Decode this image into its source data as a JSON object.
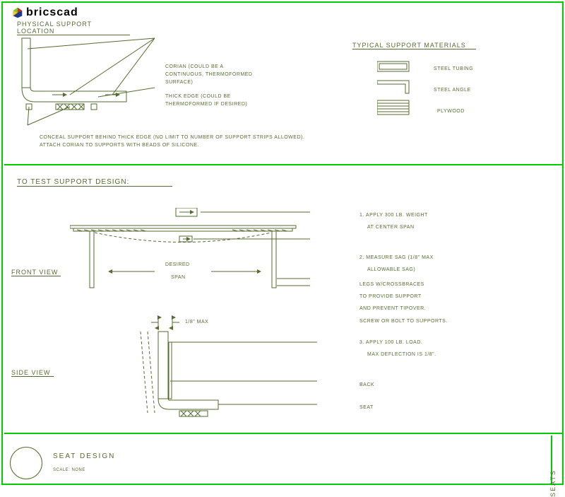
{
  "logo": "bricscad",
  "section1": {
    "title": "PHYSICAL SUPPORT LOCATION",
    "ann_corian": "CORIAN (COULD BE A",
    "ann_corian2": "CONTINUOUS, THERMOFORMED",
    "ann_corian3": "SURFACE)",
    "ann_thick": "THICK EDGE (COULD BE",
    "ann_thick2": "THERMOFORMED IF DESIRED)",
    "ann_conceal": "CONCEAL SUPPORT BEHIND THICK EDGE (NO LIMIT TO NUMBER OF SUPPORT STRIPS ALLOWED).",
    "ann_attach": "ATTACH CORIAN TO SUPPORTS WITH BEADS OF SILICONE."
  },
  "materials": {
    "title": "TYPICAL SUPPORT MATERIALS",
    "tubing": "STEEL TUBING",
    "angle": "STEEL ANGLE",
    "plywood": "PLYWOOD"
  },
  "section2": {
    "title": "TO TEST SUPPORT DESIGN:",
    "front": "FRONT VIEW",
    "side": "SIDE VIEW",
    "desired": "DESIRED",
    "span": "SPAN",
    "max": "1/8\" MAX",
    "step1a": "1. APPLY 300 LB. WEIGHT",
    "step1b": "AT CENTER SPAN",
    "step2a": "2. MEASURE SAG (1/8\" MAX",
    "step2b": "ALLOWABLE SAG)",
    "legs1": "LEGS W/CROSSBRACES",
    "legs2": "TO PROVIDE SUPPORT",
    "legs3": "AND PREVENT TIPOVER.",
    "legs4": "SCREW OR BOLT TO SUPPORTS.",
    "step3a": "3. APPLY 100 LB. LOAD.",
    "step3b": "MAX DEFLECTION IS 1/8\".",
    "back": "BACK",
    "seat": "SEAT"
  },
  "title_block": {
    "name": "SEAT DESIGN",
    "scale": "SCALE: NONE"
  },
  "side_label": "SEATS"
}
